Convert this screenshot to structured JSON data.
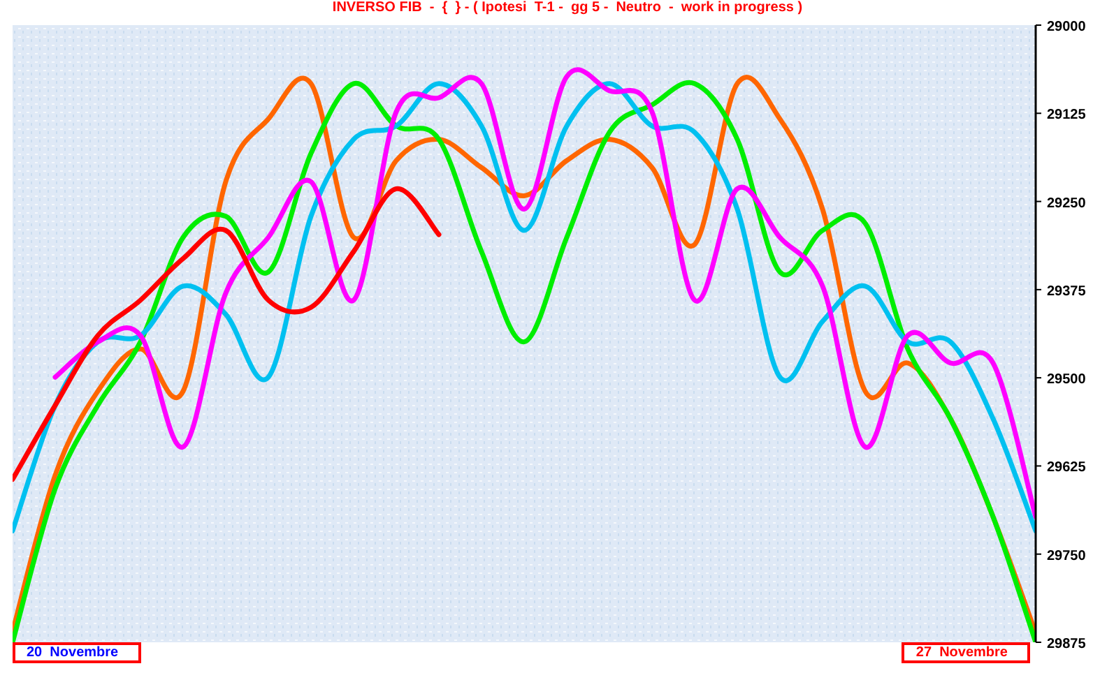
{
  "chart": {
    "chart_data": {
      "type": "line",
      "title": "INVERSO FIB  -  {  } - ( Ipotesi  T-1 -  gg 5 -  Neutro  -  work in progress )",
      "ylim": [
        29875,
        29000
      ],
      "yticks": [
        29000,
        29125,
        29250,
        29375,
        29500,
        29625,
        29750,
        29875
      ],
      "series": [
        {
          "color": "#ff6600",
          "values": [
            29860,
            29638,
            29519,
            29459,
            29519,
            29222,
            29133,
            29083,
            29301,
            29192,
            29162,
            29202,
            29242,
            29192,
            29162,
            29202,
            29311,
            29083,
            29133,
            29261,
            29519,
            29479,
            29558,
            29697,
            29862
          ]
        },
        {
          "color": "#00ee00",
          "values": [
            29875,
            29657,
            29539,
            29449,
            29301,
            29271,
            29350,
            29182,
            29083,
            29143,
            29162,
            29321,
            29449,
            29301,
            29152,
            29113,
            29083,
            29162,
            29350,
            29291,
            29281,
            29459,
            29558,
            29697,
            29875
          ]
        },
        {
          "color": "#00c0f0",
          "values": [
            29717,
            29539,
            29449,
            29440,
            29370,
            29410,
            29499,
            29271,
            29162,
            29143,
            29083,
            29143,
            29291,
            29143,
            29083,
            29143,
            29152,
            29261,
            29499,
            29420,
            29370,
            29449,
            29449,
            29558,
            29717
          ]
        },
        {
          "color": "#ff00ff",
          "values": [
            null,
            29499,
            29449,
            29440,
            29598,
            29380,
            29301,
            29222,
            29390,
            29123,
            29103,
            29083,
            29261,
            29073,
            29093,
            29123,
            29390,
            29232,
            29301,
            29370,
            29598,
            29440,
            29479,
            29479,
            29697
          ]
        },
        {
          "color": "#ff0000",
          "values": [
            29644,
            29539,
            29440,
            29390,
            29331,
            29291,
            29390,
            29400,
            29321,
            29232,
            29297,
            null,
            null,
            null,
            null,
            null,
            null,
            null,
            null,
            null,
            null,
            null,
            null,
            null,
            null
          ]
        }
      ]
    }
  },
  "date_labels": [
    {
      "text": "20  Novembre",
      "color": "#0000ff"
    },
    {
      "text": "27  Novembre",
      "color": "#ff0000"
    }
  ]
}
